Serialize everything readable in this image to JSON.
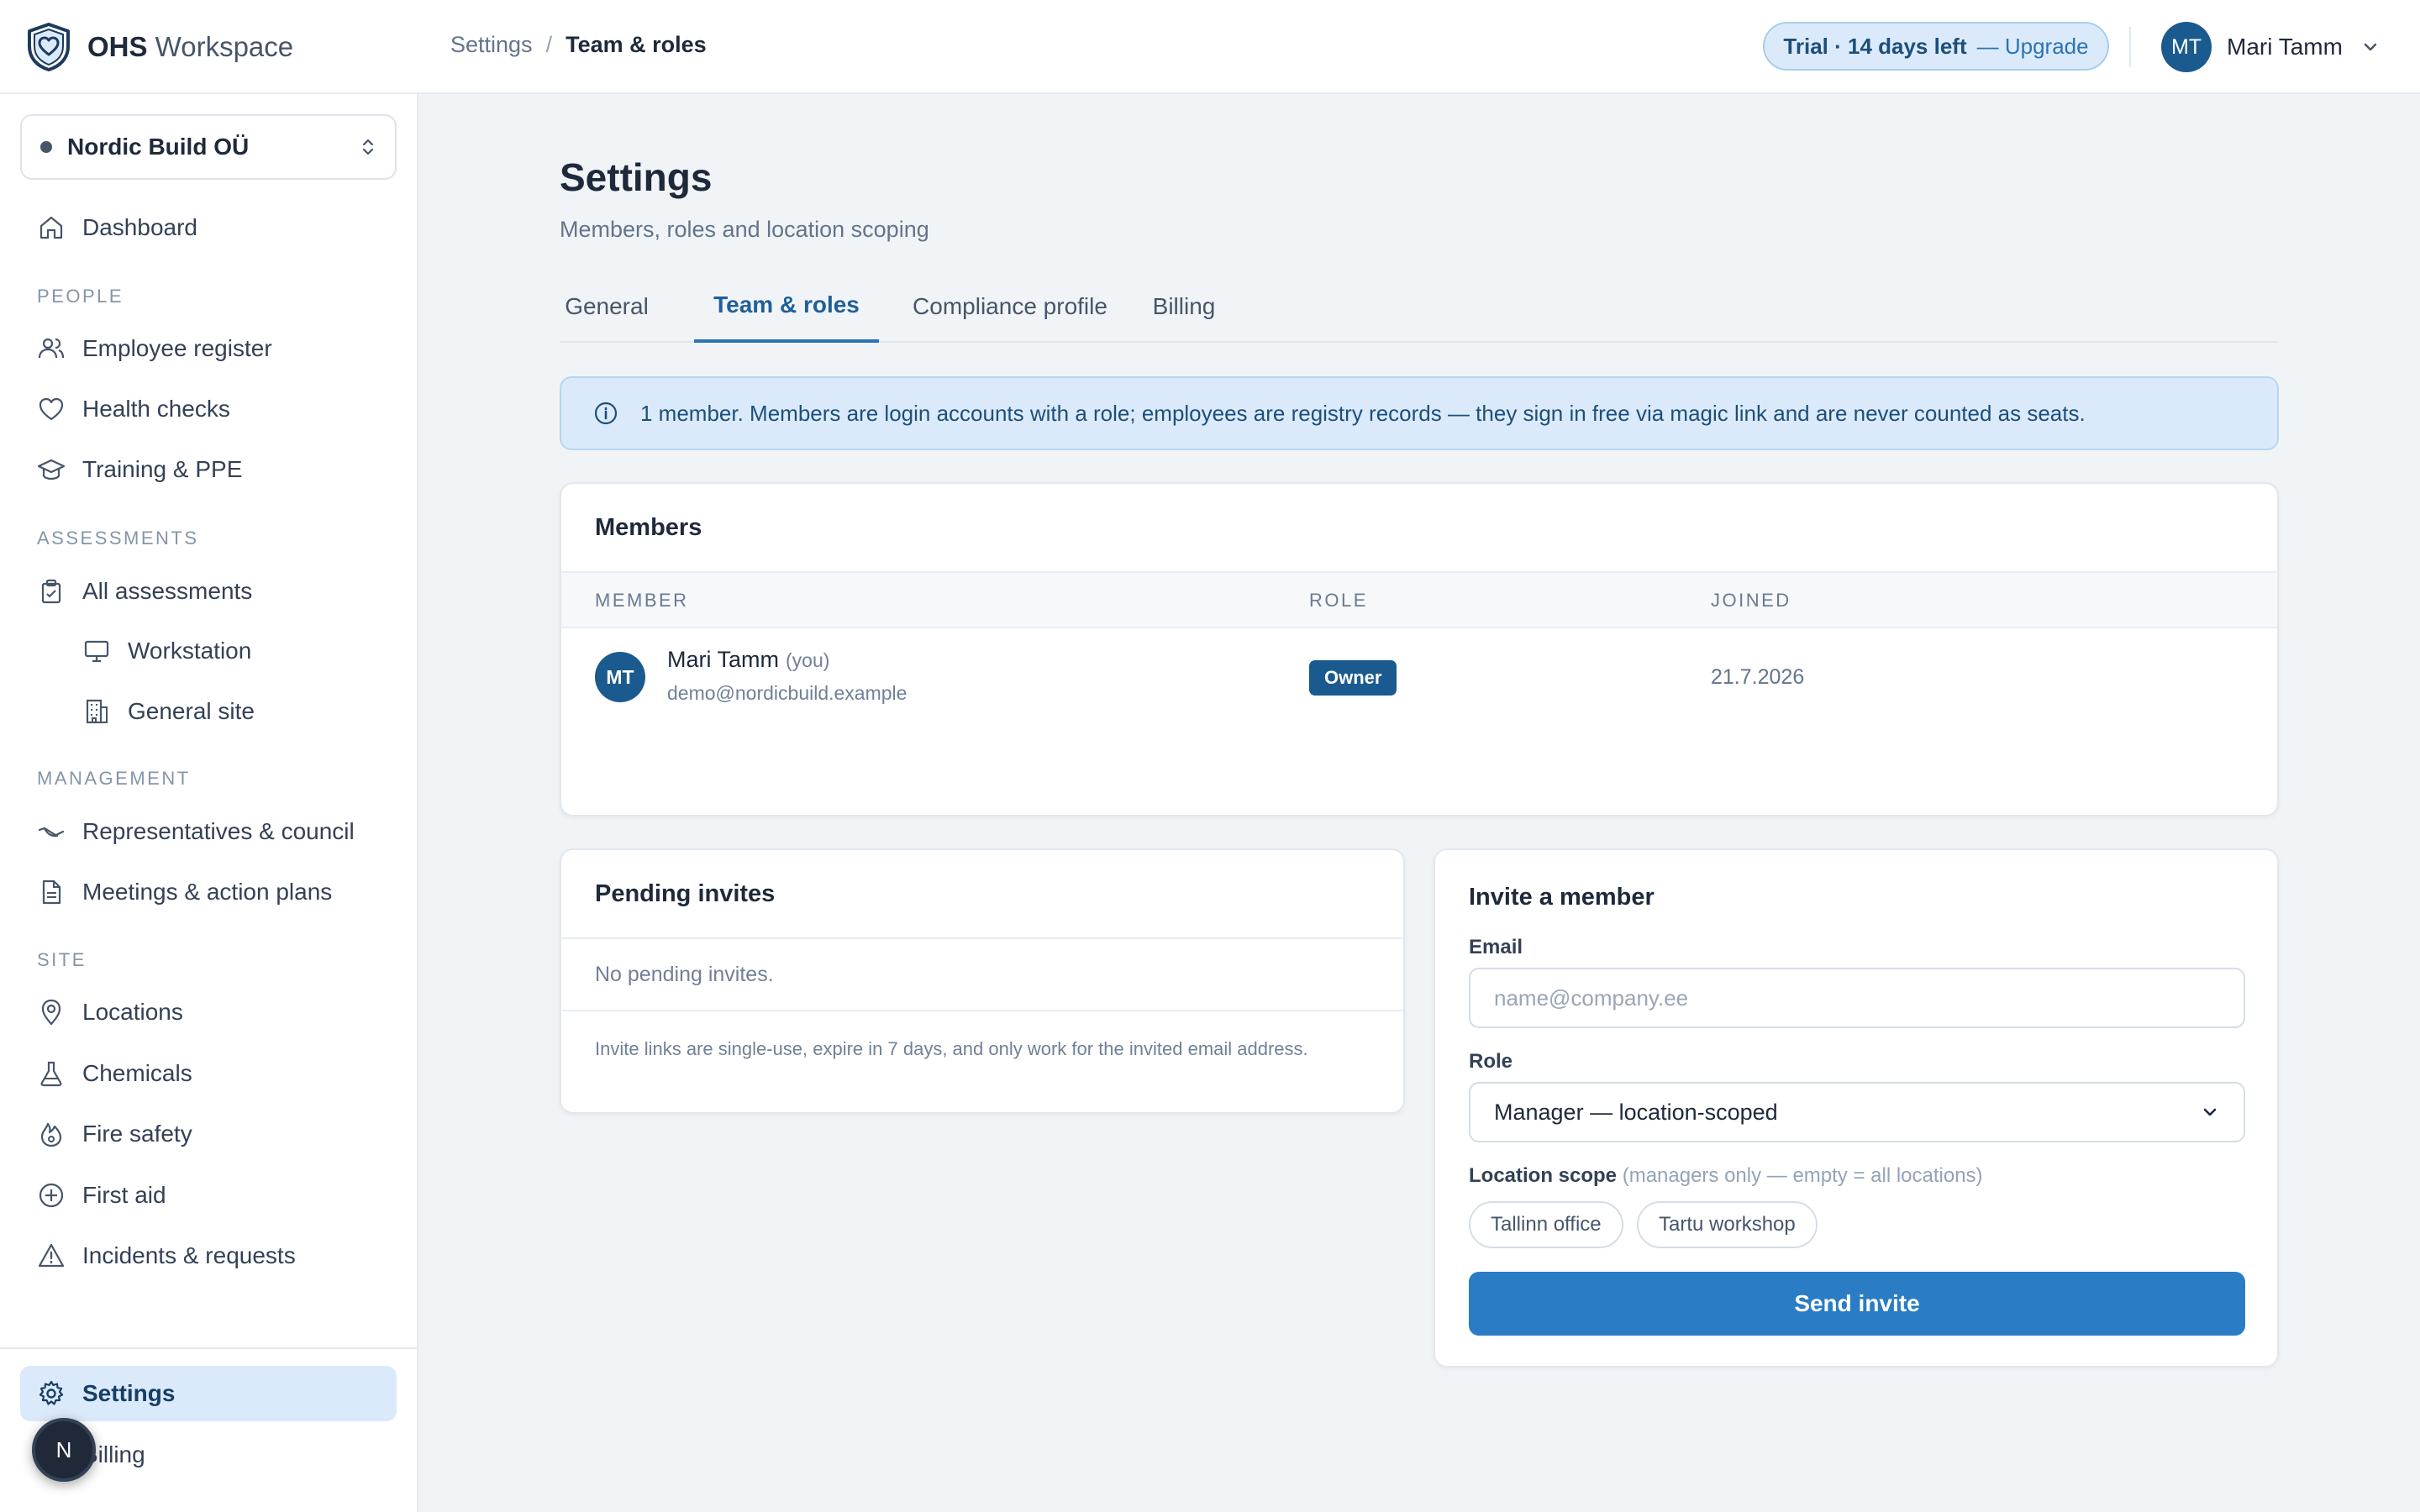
{
  "brand": {
    "name_bold": "OHS",
    "name_rest": " Workspace",
    "icon": "shield-heart-icon"
  },
  "breadcrumb": {
    "parent": "Settings",
    "separator": "/",
    "current": "Team & roles"
  },
  "trial": {
    "text": "Trial · 14 days left",
    "upgrade": "— Upgrade"
  },
  "user": {
    "initials": "MT",
    "name": "Mari Tamm"
  },
  "org": {
    "name": "Nordic Build OÜ"
  },
  "sidebar": {
    "dashboard": "Dashboard",
    "sections": {
      "people": "PEOPLE",
      "assessments": "ASSESSMENTS",
      "management": "MANAGEMENT",
      "site": "SITE"
    },
    "items": {
      "employee_register": "Employee register",
      "health_checks": "Health checks",
      "training_ppe": "Training & PPE",
      "all_assessments": "All assessments",
      "workstation": "Workstation",
      "general_site": "General site",
      "representatives": "Representatives & council",
      "meetings": "Meetings & action plans",
      "locations": "Locations",
      "chemicals": "Chemicals",
      "fire_safety": "Fire safety",
      "first_aid": "First aid",
      "incidents": "Incidents & requests",
      "settings": "Settings",
      "billing": "Billing"
    },
    "floating_badge": "N"
  },
  "page": {
    "title": "Settings",
    "subtitle": "Members, roles and location scoping"
  },
  "tabs": [
    "General",
    "Team & roles",
    "Compliance profile",
    "Billing"
  ],
  "info_banner": "1 member. Members are login accounts with a role; employees are registry records — they sign in free via magic link and are never counted as seats.",
  "members": {
    "title": "Members",
    "columns": [
      "MEMBER",
      "ROLE",
      "JOINED"
    ],
    "rows": [
      {
        "initials": "MT",
        "name": "Mari Tamm",
        "you": "(you)",
        "email": "demo@nordicbuild.example",
        "role": "Owner",
        "joined": "21.7.2026"
      }
    ]
  },
  "pending": {
    "title": "Pending invites",
    "empty": "No pending invites.",
    "note": "Invite links are single-use, expire in 7 days, and only work for the invited email address."
  },
  "invite": {
    "title": "Invite a member",
    "email_label": "Email",
    "email_placeholder": "name@company.ee",
    "email_value": "",
    "role_label": "Role",
    "role_value": "Manager — location-scoped",
    "scope_label": "Location scope",
    "scope_hint": "(managers only — empty = all locations)",
    "locations": [
      "Tallinn office",
      "Tartu workshop"
    ],
    "send": "Send invite"
  },
  "colors": {
    "accent": "#2a7cc4",
    "accent_dark": "#1a5a8f",
    "active_bg": "#dbeafa",
    "main_bg": "#f1f4f7",
    "text": "#1e293b"
  }
}
